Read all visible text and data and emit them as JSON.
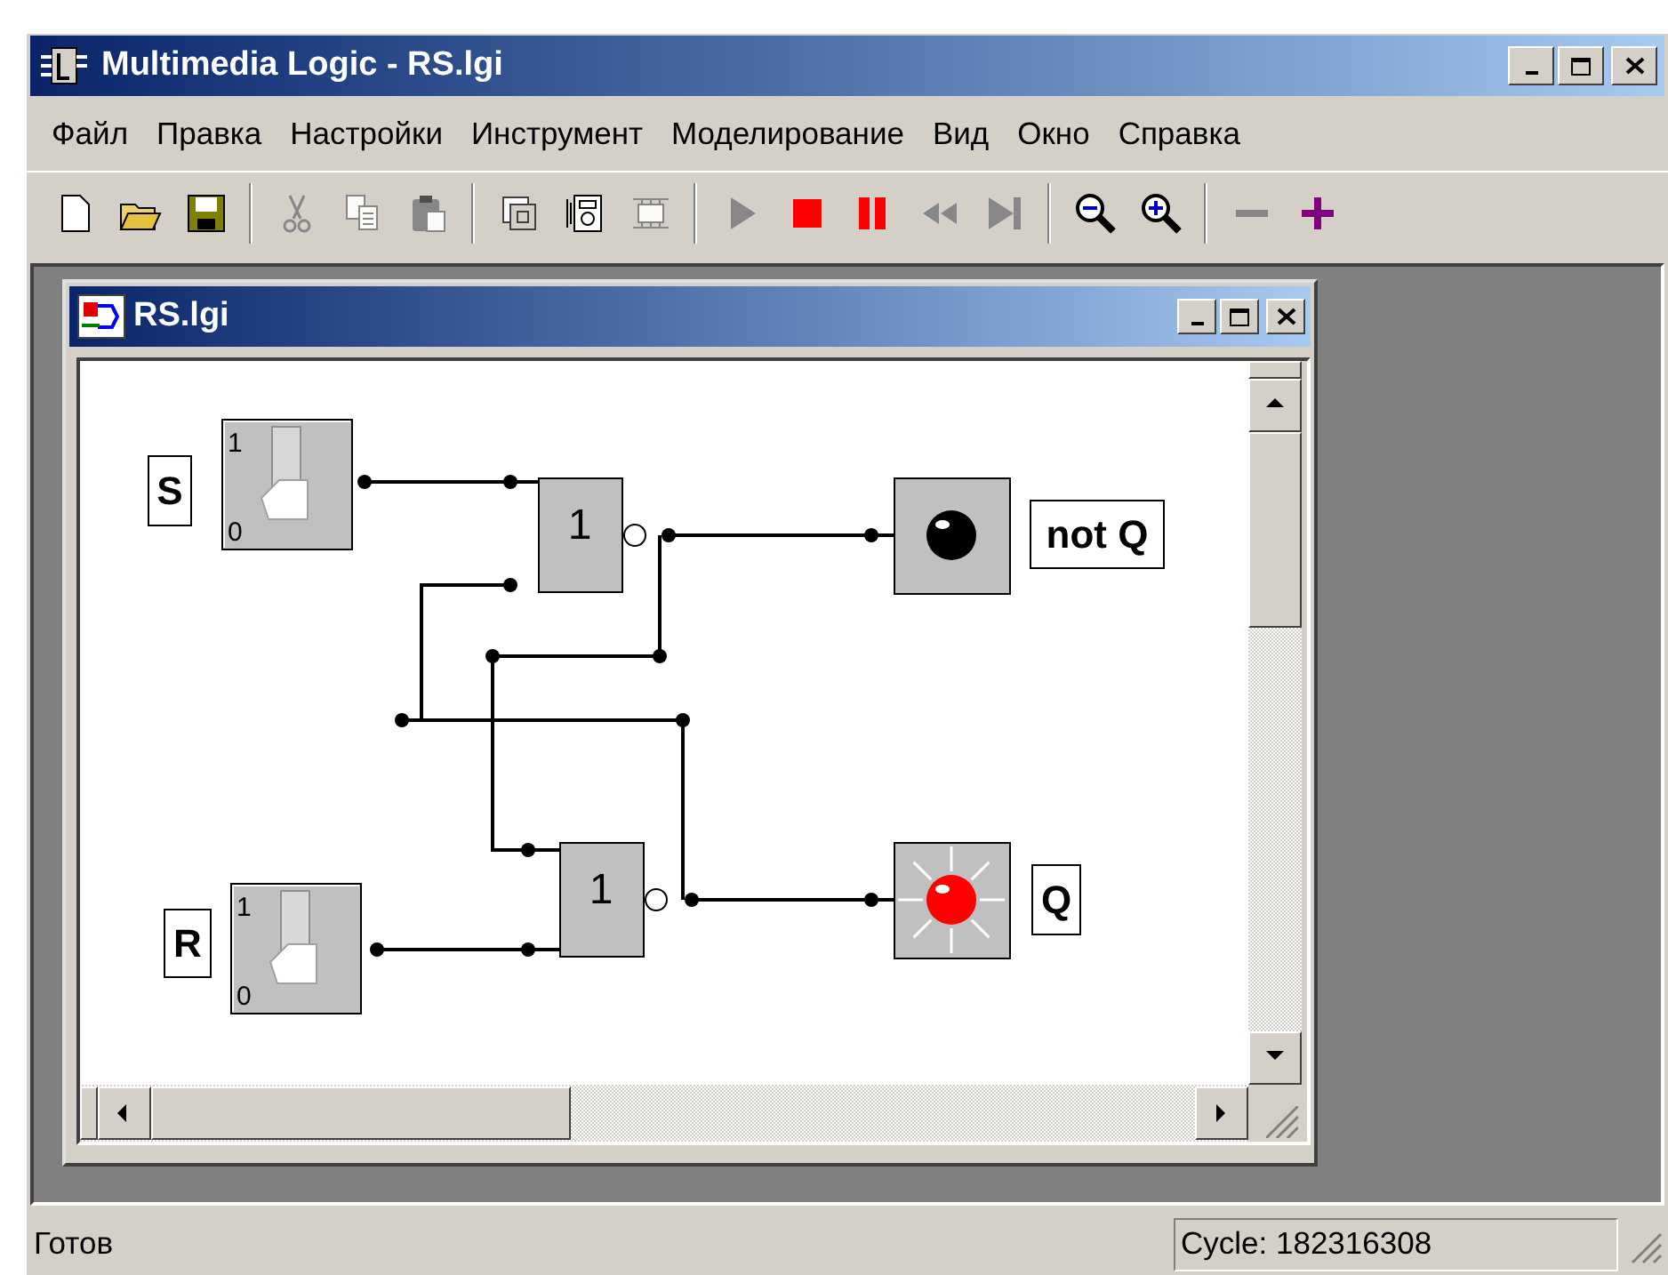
{
  "window": {
    "title": "Multimedia Logic - RS.lgi"
  },
  "menu": [
    "Файл",
    "Правка",
    "Настройки",
    "Инструмент",
    "Моделирование",
    "Вид",
    "Окно",
    "Справка"
  ],
  "toolbar": [
    {
      "kind": "new",
      "disabled": false
    },
    {
      "kind": "open",
      "disabled": false
    },
    {
      "kind": "save",
      "disabled": false
    },
    {
      "kind": "separator"
    },
    {
      "kind": "cut",
      "disabled": true
    },
    {
      "kind": "copy",
      "disabled": true
    },
    {
      "kind": "paste",
      "disabled": true
    },
    {
      "kind": "separator"
    },
    {
      "kind": "frame",
      "disabled": false
    },
    {
      "kind": "device",
      "disabled": false
    },
    {
      "kind": "chip",
      "disabled": true
    },
    {
      "kind": "separator"
    },
    {
      "kind": "play",
      "disabled": true
    },
    {
      "kind": "stop",
      "disabled": false
    },
    {
      "kind": "pause",
      "disabled": false
    },
    {
      "kind": "rewind",
      "disabled": true
    },
    {
      "kind": "step",
      "disabled": true
    },
    {
      "kind": "separator"
    },
    {
      "kind": "zoomout",
      "disabled": false
    },
    {
      "kind": "zoomin",
      "disabled": false
    },
    {
      "kind": "separator"
    },
    {
      "kind": "minus",
      "disabled": true
    },
    {
      "kind": "plus",
      "disabled": false
    }
  ],
  "document": {
    "title": "RS.lgi",
    "circuit": {
      "tags": [
        "S",
        "not Q",
        "Q",
        "R"
      ],
      "switches": [
        {
          "high": "1",
          "low": "0",
          "on": false
        },
        {
          "high": "1",
          "low": "0",
          "on": false
        }
      ],
      "gates": [
        {
          "symbol": "1"
        },
        {
          "symbol": "1"
        }
      ],
      "lamps": [
        {
          "lit": false
        },
        {
          "lit": true
        }
      ]
    }
  },
  "status_bar": {
    "message": "Готов",
    "cycle": "Cycle: 182316308"
  }
}
